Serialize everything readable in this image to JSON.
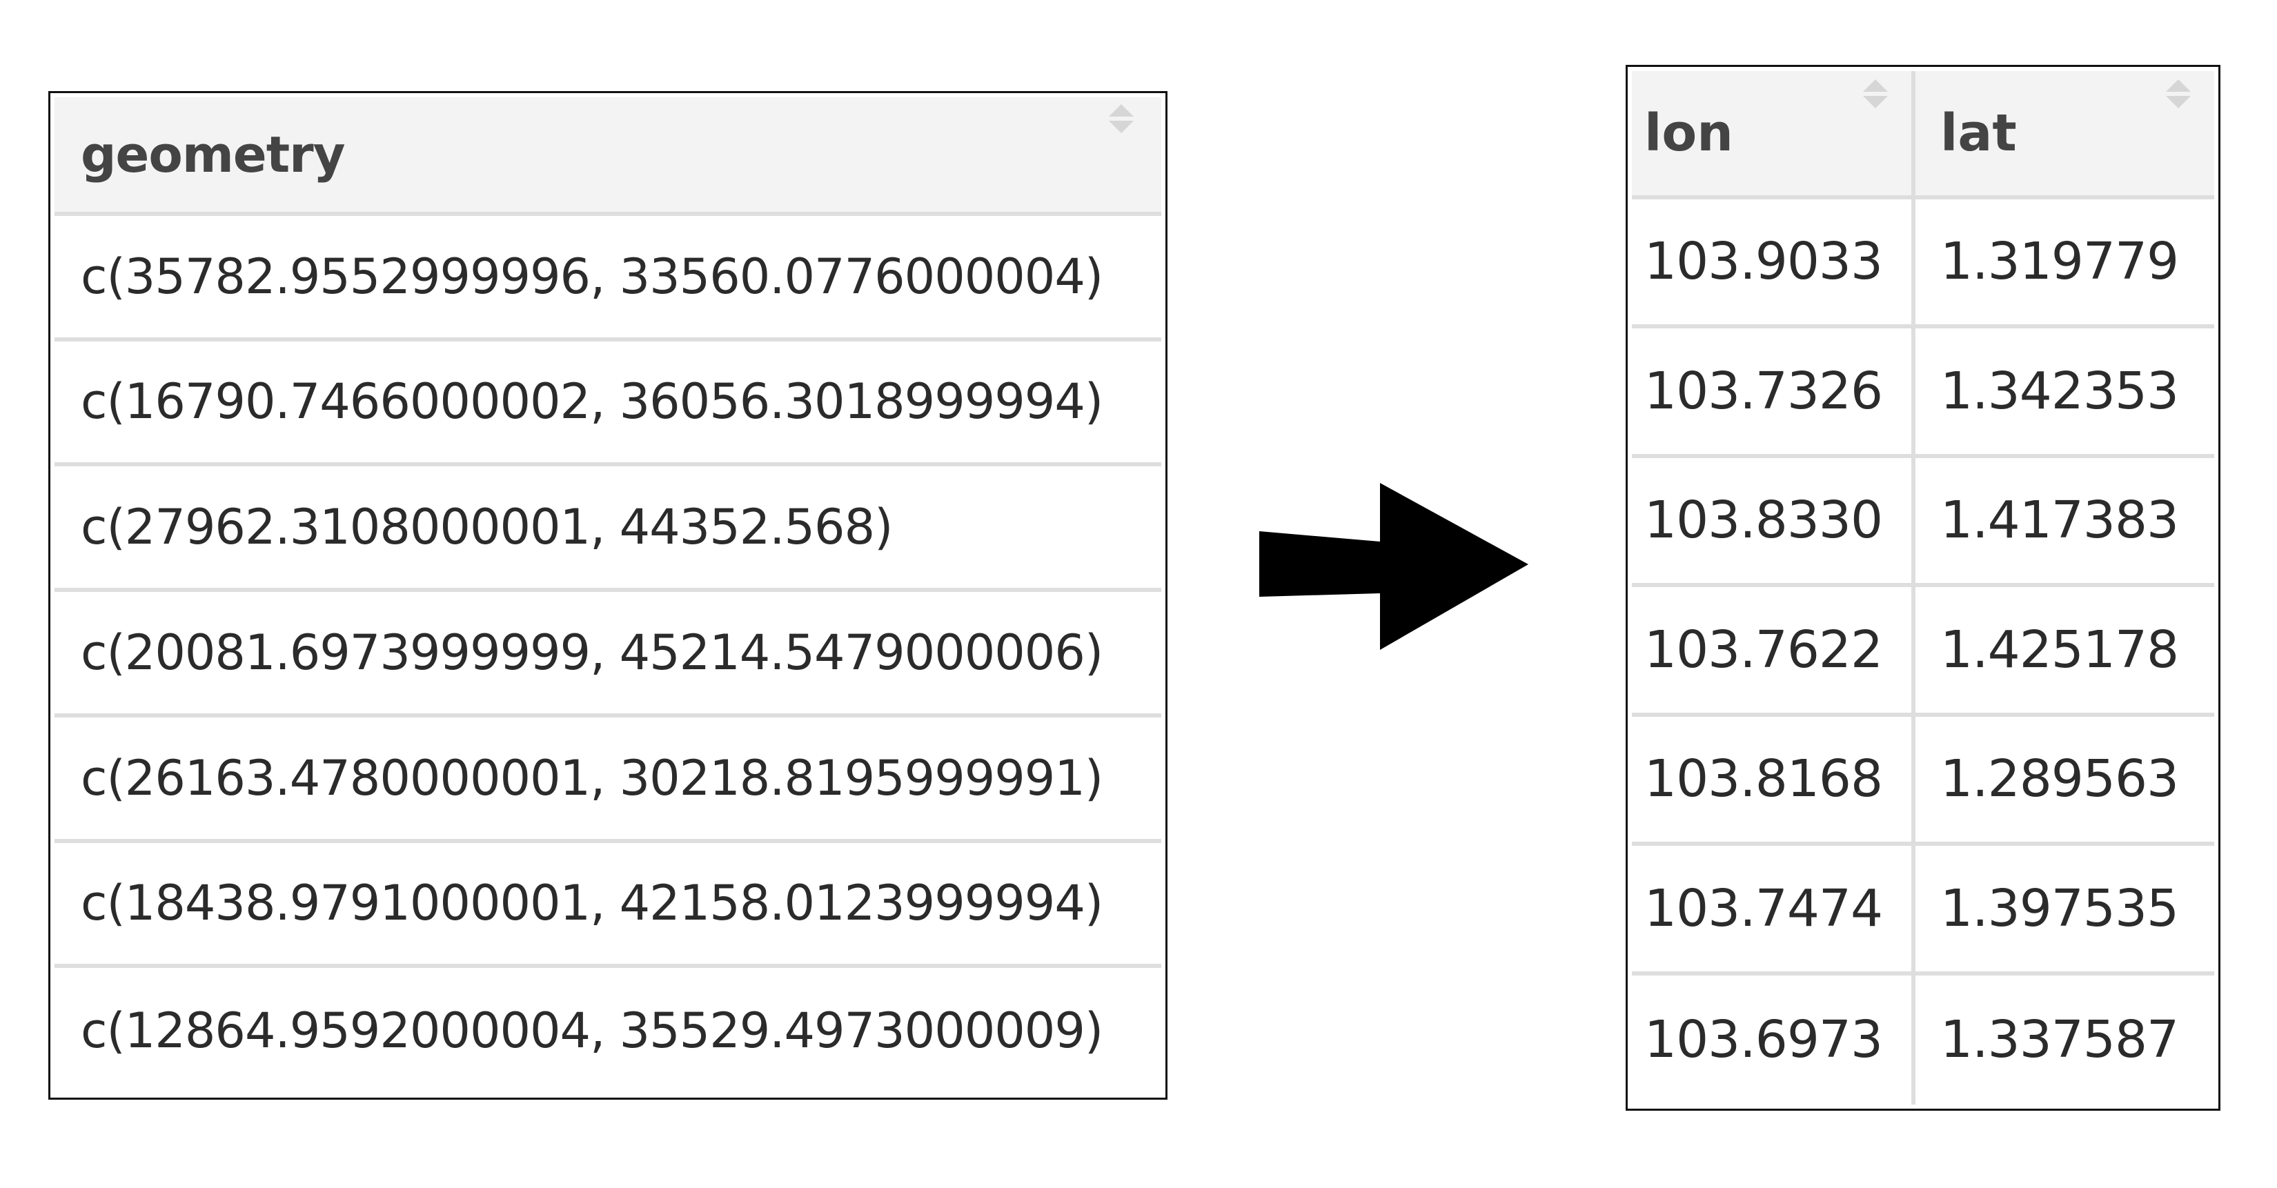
{
  "geometry_table": {
    "column_header": "geometry",
    "rows": [
      "c(35782.9552999996, 33560.0776000004)",
      "c(16790.7466000002, 36056.3018999994)",
      "c(27962.3108000001, 44352.568)",
      "c(20081.6973999999, 45214.5479000006)",
      "c(26163.4780000001, 30218.8195999991)",
      "c(18438.9791000001, 42158.0123999994)",
      "c(12864.9592000004, 35529.4973000009)"
    ]
  },
  "arrow": {
    "icon": "right-arrow-icon",
    "color": "#000000"
  },
  "coord_table": {
    "headers": {
      "lon": "lon",
      "lat": "lat"
    },
    "rows": [
      {
        "lon": "103.9033",
        "lat": "1.319779"
      },
      {
        "lon": "103.7326",
        "lat": "1.342353"
      },
      {
        "lon": "103.8330",
        "lat": "1.417383"
      },
      {
        "lon": "103.7622",
        "lat": "1.425178"
      },
      {
        "lon": "103.8168",
        "lat": "1.289563"
      },
      {
        "lon": "103.7474",
        "lat": "1.397535"
      },
      {
        "lon": "103.6973",
        "lat": "1.337587"
      }
    ]
  },
  "colors": {
    "header_bg": "#f3f3f3",
    "grid_line": "#dedede",
    "border": "#111111",
    "sort_icon": "#d6d6d6"
  }
}
